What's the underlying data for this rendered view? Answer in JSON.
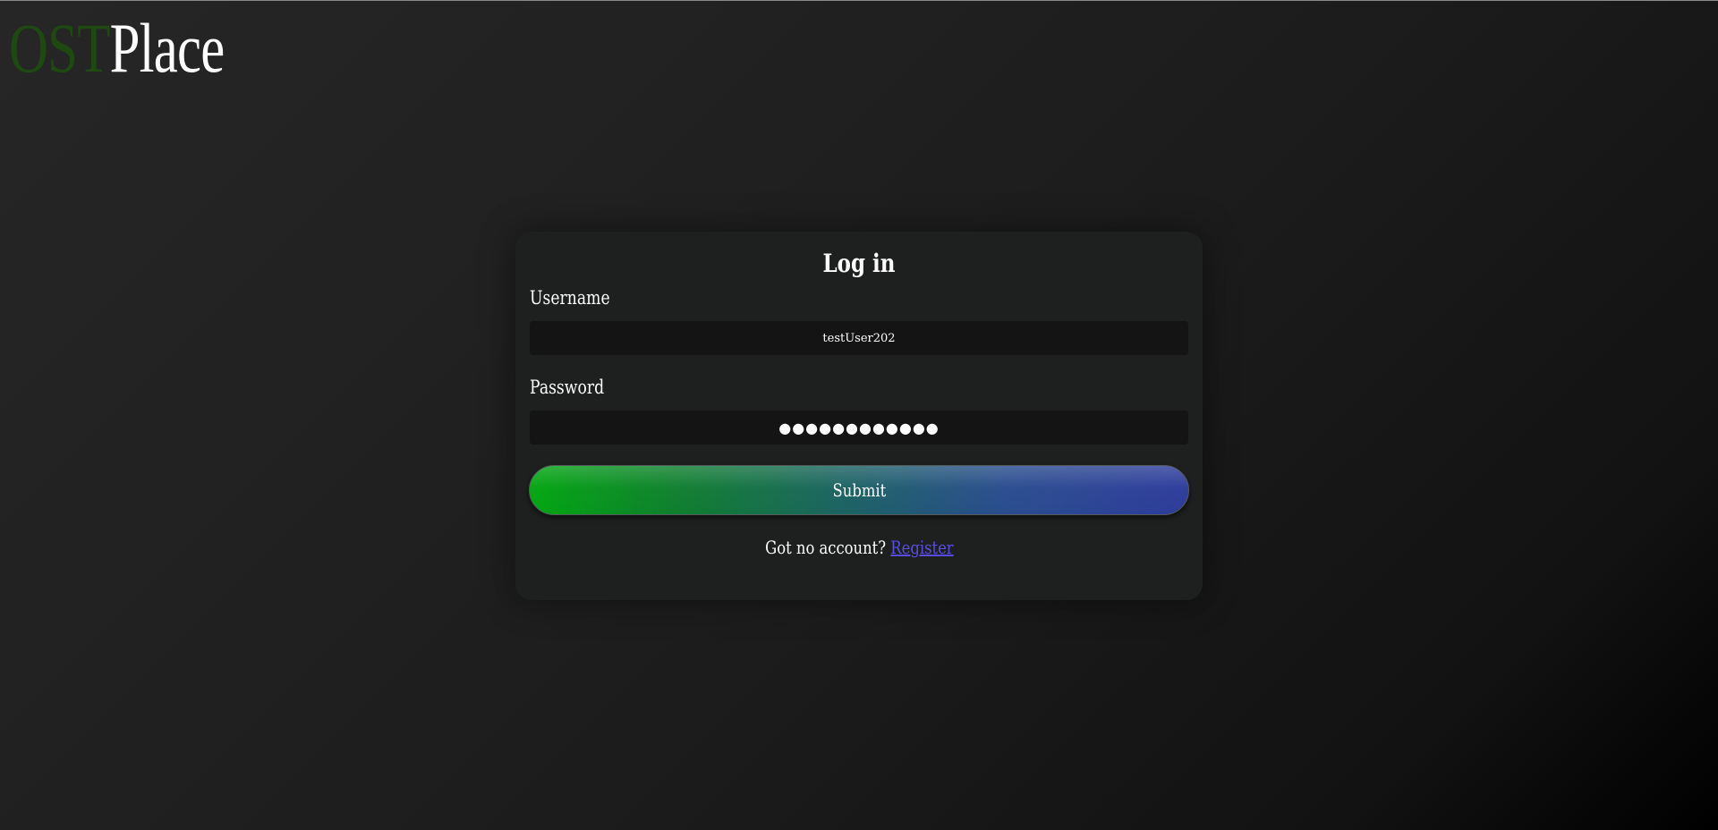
{
  "logo": {
    "part1": "OST",
    "part2": "Place"
  },
  "login": {
    "title": "Log in",
    "username_label": "Username",
    "username_value": "testUser202",
    "password_label": "Password",
    "password_value": "●●●●●●●●●●●●",
    "submit_label": "Submit",
    "register_prompt": "Got no account?",
    "register_link": "Register"
  },
  "colors": {
    "logo_ost": "#1e4a12",
    "card_bg": "#1e2020",
    "input_bg": "#141414",
    "button_gradient_start": "#02a611",
    "button_gradient_end": "#2e3c9b",
    "link": "#5a4de6"
  }
}
